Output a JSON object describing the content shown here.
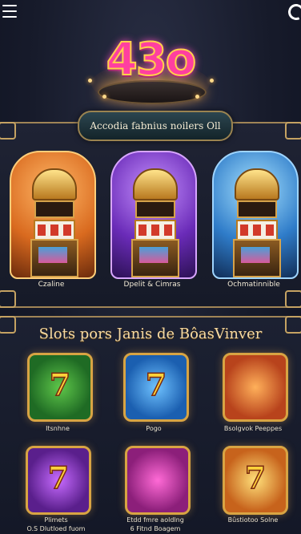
{
  "header": {
    "logo_text": "43o"
  },
  "banner": {
    "text": "Accodia fabnius noilers Oll"
  },
  "featured": [
    {
      "label": "Czaline"
    },
    {
      "label": "Dpelit & Cimras"
    },
    {
      "label": "Ochmatinnible"
    }
  ],
  "slots_section": {
    "title": "Slots pors Janis de BôasVinver",
    "tiles": [
      {
        "label": "Itsnhne",
        "glyph": "7"
      },
      {
        "label": "Pogo",
        "glyph": "7"
      },
      {
        "label": "Bsolgvok Peeppes",
        "glyph": ""
      },
      {
        "label": "Plimets",
        "glyph": "7"
      },
      {
        "label": "Etdd fmre aoldlng",
        "glyph": ""
      },
      {
        "label": "Bûstiotoo Solne",
        "glyph": "7"
      }
    ],
    "sublabels": [
      "O.S Dlutloed fuom",
      "6 Fitnd Boagem"
    ]
  },
  "colors": {
    "accent_gold": "#d8a443",
    "background": "#171b2b",
    "logo_pink": "#ff3fa0"
  }
}
